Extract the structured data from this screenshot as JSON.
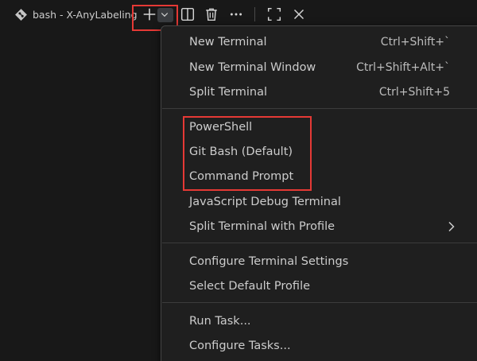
{
  "toolbar": {
    "tab_title": "bash - X-AnyLabeling",
    "tab_icon": "git-bash-diamond-icon",
    "buttons": [
      {
        "name": "new-terminal-plus-icon"
      },
      {
        "name": "launch-profile-chevron-icon"
      },
      {
        "name": "split-terminal-icon"
      },
      {
        "name": "kill-terminal-trash-icon"
      },
      {
        "name": "more-actions-ellipsis-icon"
      },
      {
        "name": "maximize-panel-icon"
      },
      {
        "name": "close-panel-icon"
      }
    ]
  },
  "menu": {
    "groups": [
      [
        {
          "label": "New Terminal",
          "keybind": "Ctrl+Shift+`"
        },
        {
          "label": "New Terminal Window",
          "keybind": "Ctrl+Shift+Alt+`"
        },
        {
          "label": "Split Terminal",
          "keybind": "Ctrl+Shift+5"
        }
      ],
      [
        {
          "label": "PowerShell"
        },
        {
          "label": "Git Bash (Default)"
        },
        {
          "label": "Command Prompt"
        },
        {
          "label": "JavaScript Debug Terminal"
        },
        {
          "label": "Split Terminal with Profile",
          "submenu": true
        }
      ],
      [
        {
          "label": "Configure Terminal Settings"
        },
        {
          "label": "Select Default Profile"
        }
      ],
      [
        {
          "label": "Run Task..."
        },
        {
          "label": "Configure Tasks..."
        }
      ]
    ]
  },
  "colors": {
    "background": "#181818",
    "menu_background": "#1f1f1f",
    "menu_border": "#454545",
    "text": "#cccccc",
    "highlight": "#e53935"
  }
}
